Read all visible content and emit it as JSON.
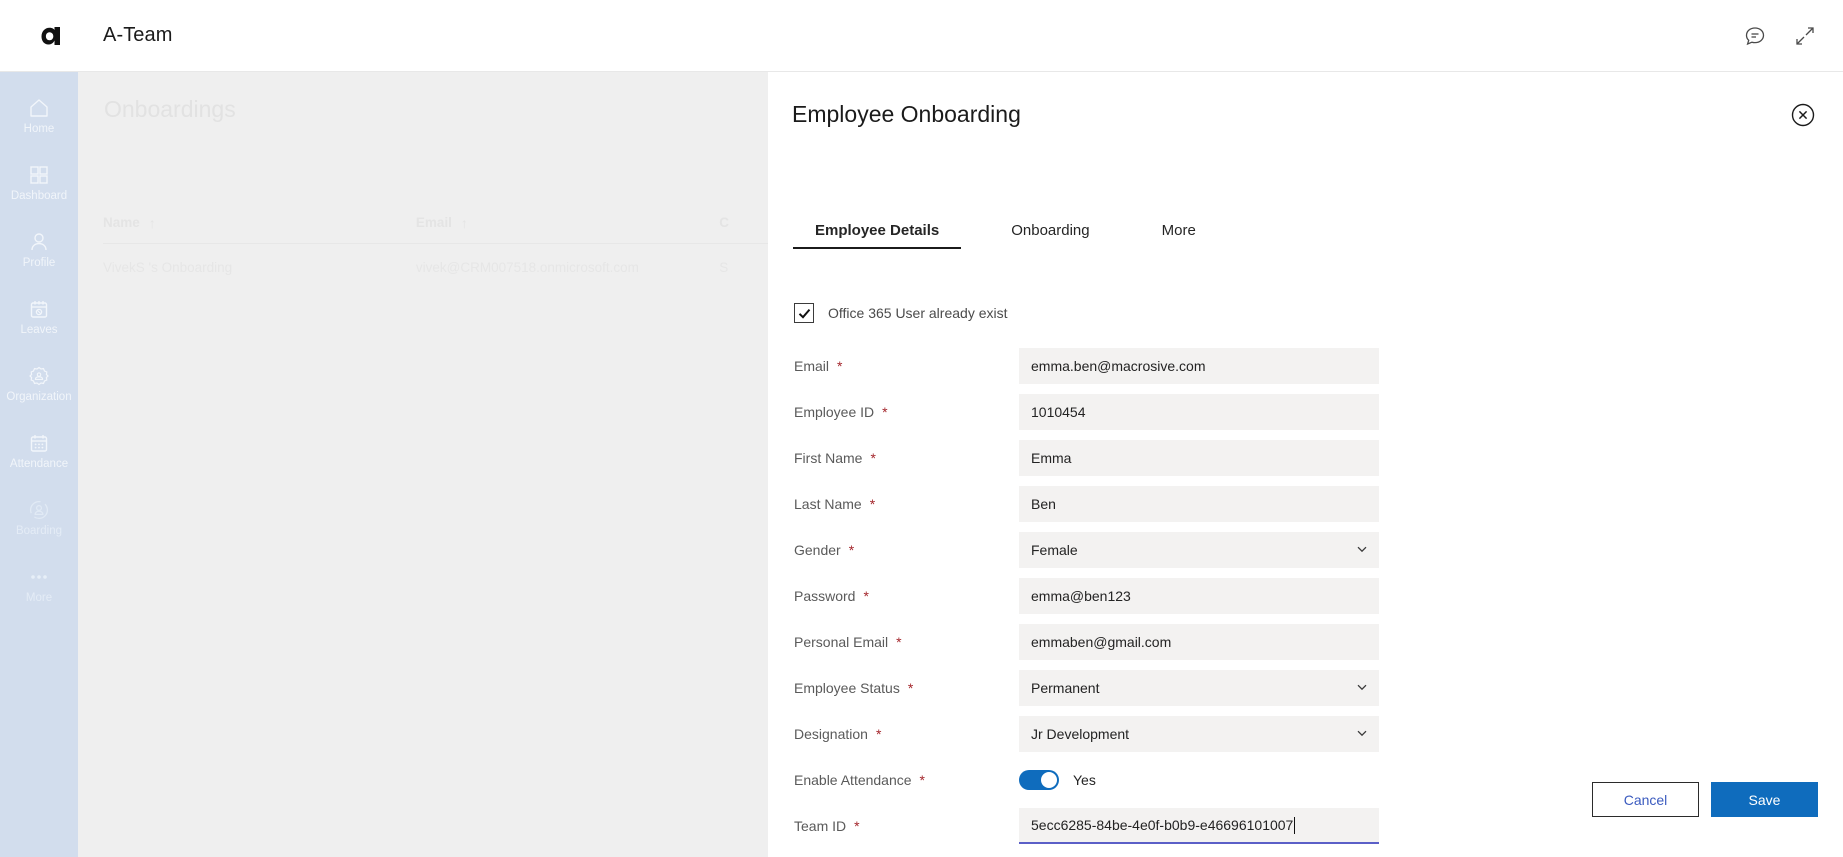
{
  "app": {
    "brand_name": "A-Team",
    "logo_icon": "a-team-logo-icon",
    "feedback_icon": "chat-bubble-icon",
    "collapse_icon": "collapse-arrows-icon"
  },
  "sidebar": {
    "items": [
      {
        "label": "Home",
        "icon": "home-icon"
      },
      {
        "label": "Dashboard",
        "icon": "grid-dashboard-icon"
      },
      {
        "label": "Profile",
        "icon": "person-icon"
      },
      {
        "label": "Leaves",
        "icon": "calendar-cancel-icon"
      },
      {
        "label": "Organization",
        "icon": "organization-gear-icon"
      },
      {
        "label": "Attendance",
        "icon": "calendar-dots-icon"
      },
      {
        "label": "Boarding",
        "icon": "person-circle-icon"
      },
      {
        "label": "More",
        "icon": "ellipsis-icon"
      }
    ]
  },
  "background_page": {
    "title": "Onboardings",
    "table": {
      "columns": [
        {
          "label": "Name",
          "sort_indicator": "↑"
        },
        {
          "label": "Email",
          "sort_indicator": "↑"
        },
        {
          "label": "C",
          "sort_indicator": ""
        }
      ],
      "rows": [
        {
          "name": "VivekS 's Onboarding",
          "email": "vivek@CRM007518.onmicrosoft.com",
          "col3": "S"
        }
      ]
    }
  },
  "panel": {
    "title": "Employee Onboarding",
    "close_icon": "close-circle-icon",
    "tabs": [
      {
        "label": "Employee Details",
        "active": true
      },
      {
        "label": "Onboarding",
        "active": false
      },
      {
        "label": "More",
        "active": false
      }
    ],
    "checkbox": {
      "label": "Office 365 User already exist",
      "checked": true,
      "check_glyph": "✓"
    },
    "fields": [
      {
        "label": "Email",
        "required": "*",
        "value": "emma.ben@macrosive.com",
        "type": "text"
      },
      {
        "label": "Employee ID",
        "required": "*",
        "value": "1010454",
        "type": "text"
      },
      {
        "label": "First Name",
        "required": "*",
        "value": "Emma",
        "type": "text"
      },
      {
        "label": "Last Name",
        "required": "*",
        "value": "Ben",
        "type": "text"
      },
      {
        "label": "Gender",
        "required": "*",
        "value": "Female",
        "type": "select"
      },
      {
        "label": "Password",
        "required": "*",
        "value": "emma@ben123",
        "type": "text"
      },
      {
        "label": "Personal Email",
        "required": "*",
        "value": "emmaben@gmail.com",
        "type": "text"
      },
      {
        "label": "Employee Status",
        "required": "*",
        "value": "Permanent",
        "type": "select"
      },
      {
        "label": "Designation",
        "required": "*",
        "value": "Jr Development",
        "type": "select"
      },
      {
        "label": "Enable Attendance",
        "required": "*",
        "value": "Yes",
        "type": "toggle"
      },
      {
        "label": "Team ID",
        "required": "*",
        "value": "5ecc6285-84be-4e0f-b0b9-e46696101007",
        "type": "text-focused"
      }
    ],
    "buttons": {
      "cancel_label": "Cancel",
      "save_label": "Save"
    }
  },
  "colors": {
    "accent_blue": "#0f6cbd",
    "sidebar_blue": "#d2dded",
    "required_red": "#a4262c",
    "field_bg": "#f3f2f1",
    "focus_underline": "#5b5fc7"
  }
}
